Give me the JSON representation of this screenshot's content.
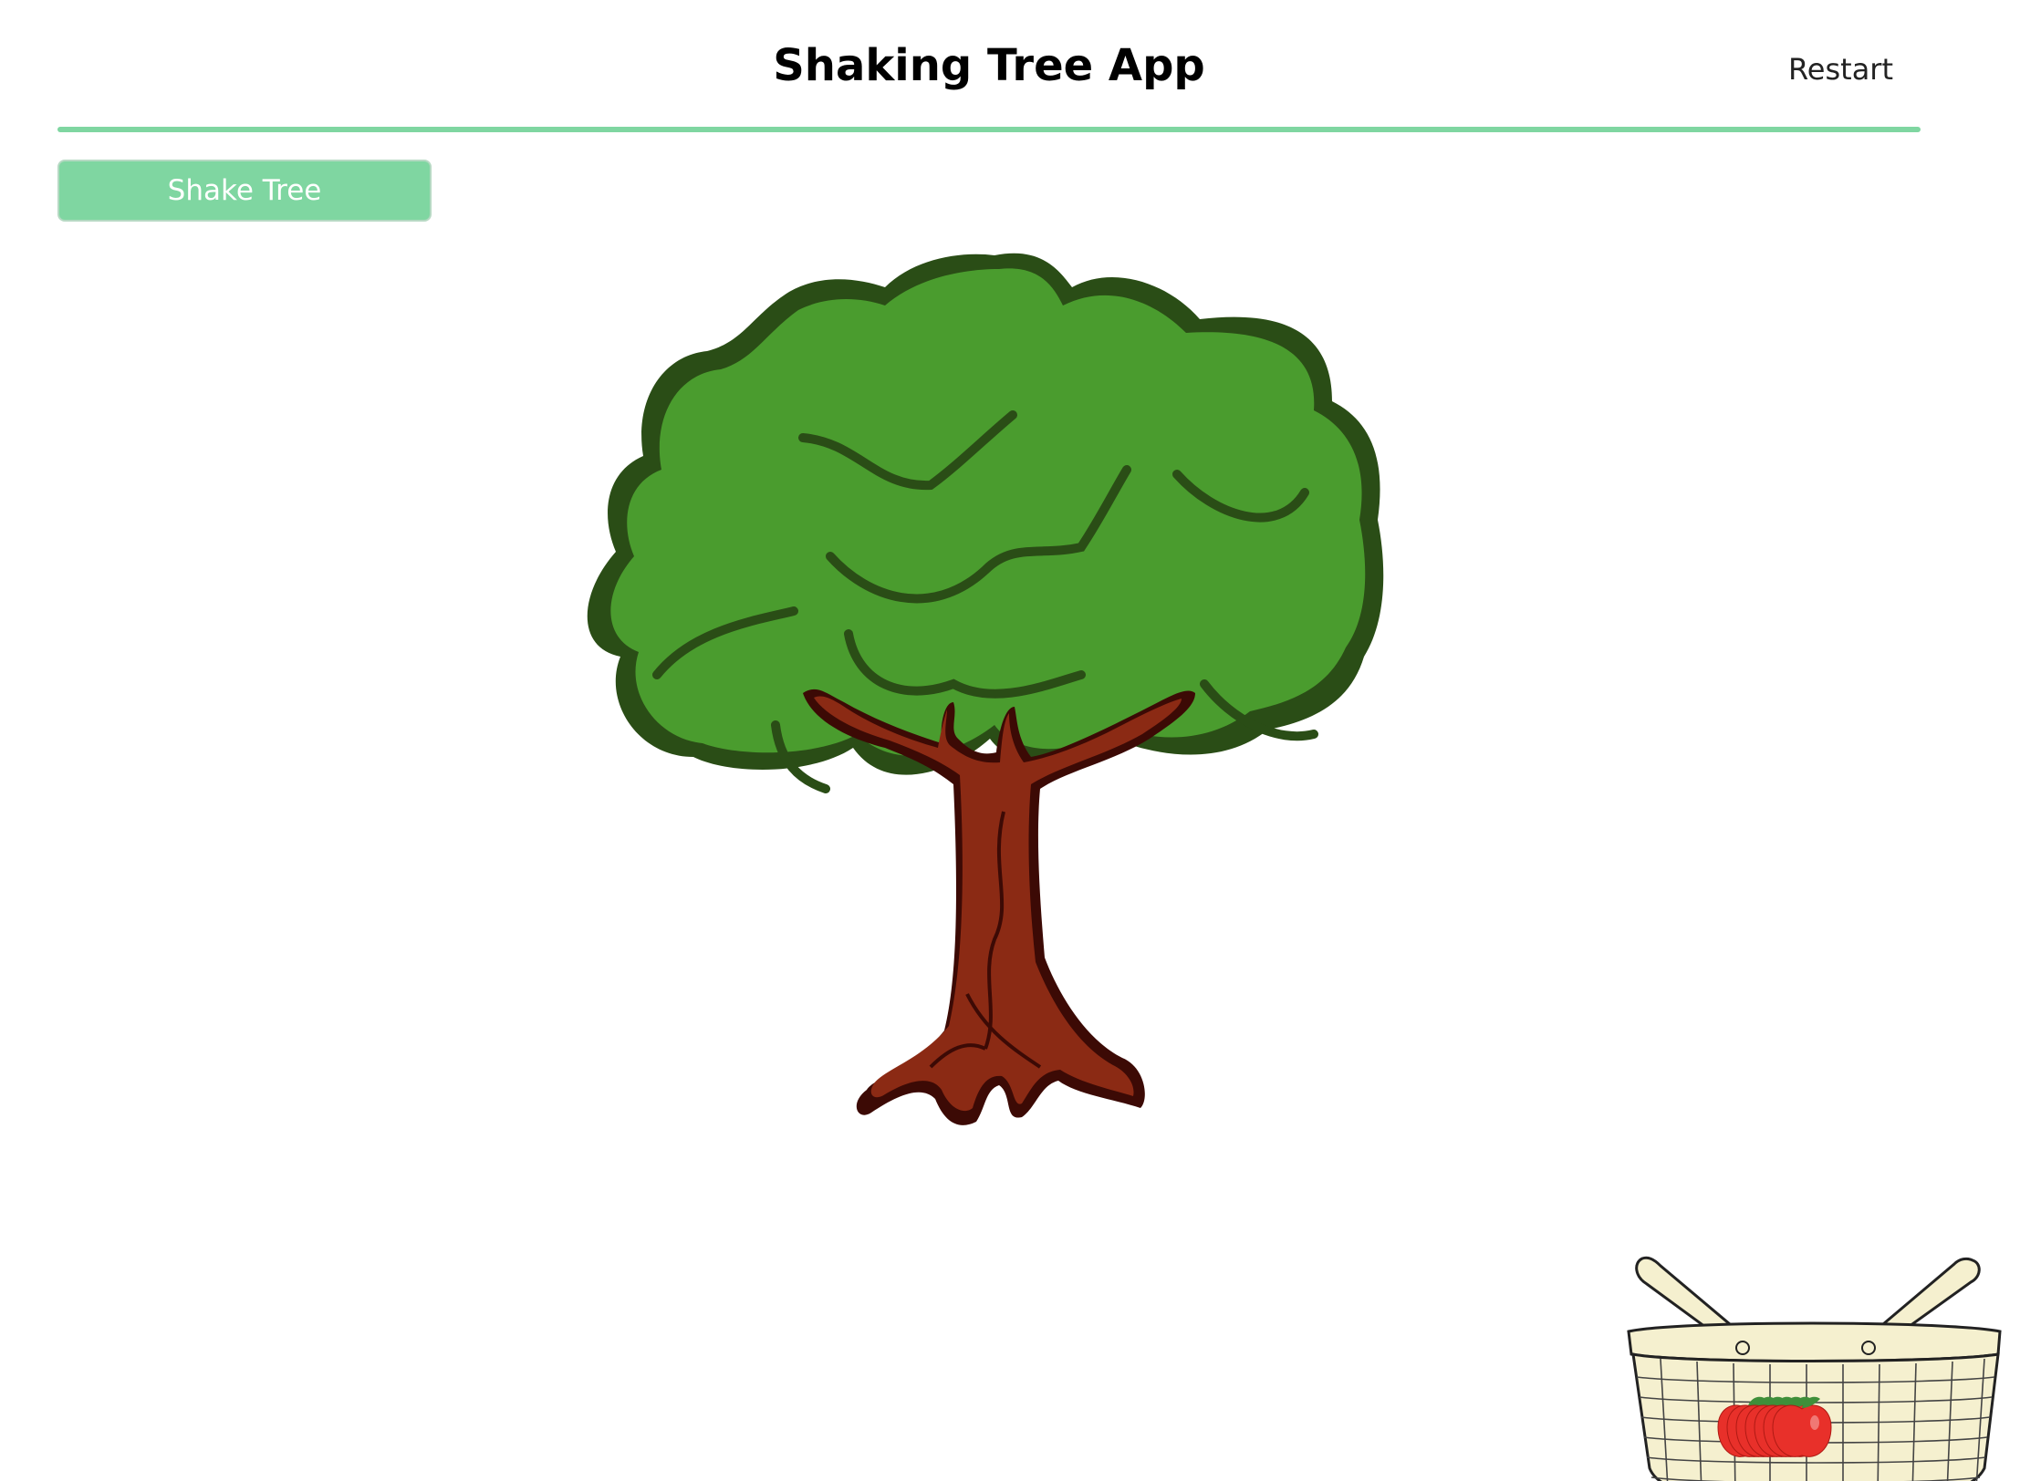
{
  "header": {
    "title": "Shaking Tree App",
    "restart_label": "Restart"
  },
  "controls": {
    "shake_label": "Shake Tree"
  },
  "scene": {
    "tree_icon": "tree-illustration",
    "basket_icon": "picnic-basket",
    "apple_icon": "red-apple",
    "apples_in_basket": 7
  },
  "colors": {
    "accent": "#7fd6a1",
    "leaf": "#4a9c2e",
    "leaf_outline": "#2a4d16",
    "trunk": "#8b2a14",
    "trunk_outline": "#3c0a05",
    "apple": "#e8302a",
    "basket": "#f5f0cf"
  }
}
